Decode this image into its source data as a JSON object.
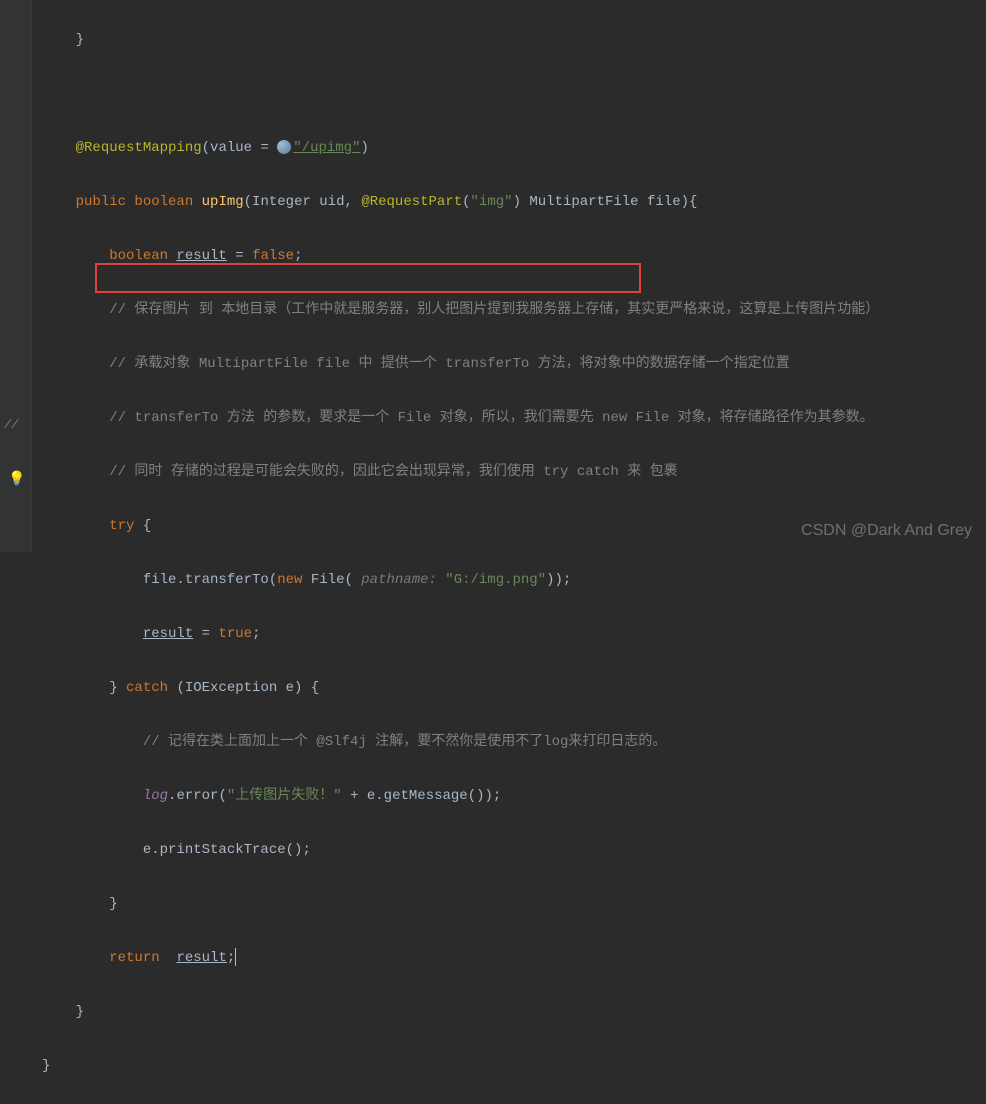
{
  "code": {
    "line1_brace": "    }",
    "line2_empty": "",
    "line3_anno": "@RequestMapping",
    "line3_param": "(value = ",
    "line3_str": "\"/upimg\"",
    "line3_close": ")",
    "line4_mod": "public boolean ",
    "line4_method": "upImg",
    "line4_p1": "(Integer ",
    "line4_uid": "uid",
    "line4_p2": ", ",
    "line4_anno2": "@RequestPart",
    "line4_p3": "(",
    "line4_str2": "\"img\"",
    "line4_p4": ") MultipartFile ",
    "line4_file": "file",
    "line4_p5": "){",
    "line5_decl": "        boolean ",
    "line5_var": "result",
    "line5_assign": " = ",
    "line5_false": "false",
    "line5_semi": ";",
    "line6_cmt": "        // 保存图片 到 本地目录（工作中就是服务器，别人把图片提到我服务器上存储，其实更严格来说，这算是上传图片功能）",
    "line7_cmt": "        // 承载对象 MultipartFile file 中 提供一个 transferTo 方法，将对象中的数据存储一个指定位置",
    "line8_cmt": "        // transferTo 方法 的参数，要求是一个 File 对象，所以，我们需要先 new File 对象，将存储路径作为其参数。",
    "line9_cmt": "        // 同时 存储的过程是可能会失败的，因此它会出现异常，我们使用 try catch 来 包裹",
    "line10_try": "        try ",
    "line10_brace": "{",
    "line11_pre": "            file.transferTo(",
    "line11_new": "new ",
    "line11_file": "File( ",
    "line11_hint": "pathname: ",
    "line11_str": "\"G:/img.png\"",
    "line11_post": "));",
    "line12_pre": "            ",
    "line12_var": "result",
    "line12_assign": " = ",
    "line12_true": "true",
    "line12_semi": ";",
    "line13_close": "        } ",
    "line13_catch": "catch ",
    "line13_paren": "(IOException e) {",
    "line14_cmt": "            // 记得在类上面加上一个 @Slf4j 注解，要不然你是使用不了log来打印日志的。",
    "line15_pre": "            ",
    "line15_log": "log",
    "line15_err": ".error(",
    "line15_str": "\"上传图片失败！\" ",
    "line15_plus": "+ e.getMessage());",
    "line16_stk": "            e.printStackTrace();",
    "line17_brace": "        }",
    "line18_pre": "        ",
    "line18_ret": "return  ",
    "line18_var": "result",
    "line18_semi": ";",
    "line19_brace": "    }",
    "line20_brace": "}"
  },
  "watermark": "CSDN @Dark And Grey"
}
